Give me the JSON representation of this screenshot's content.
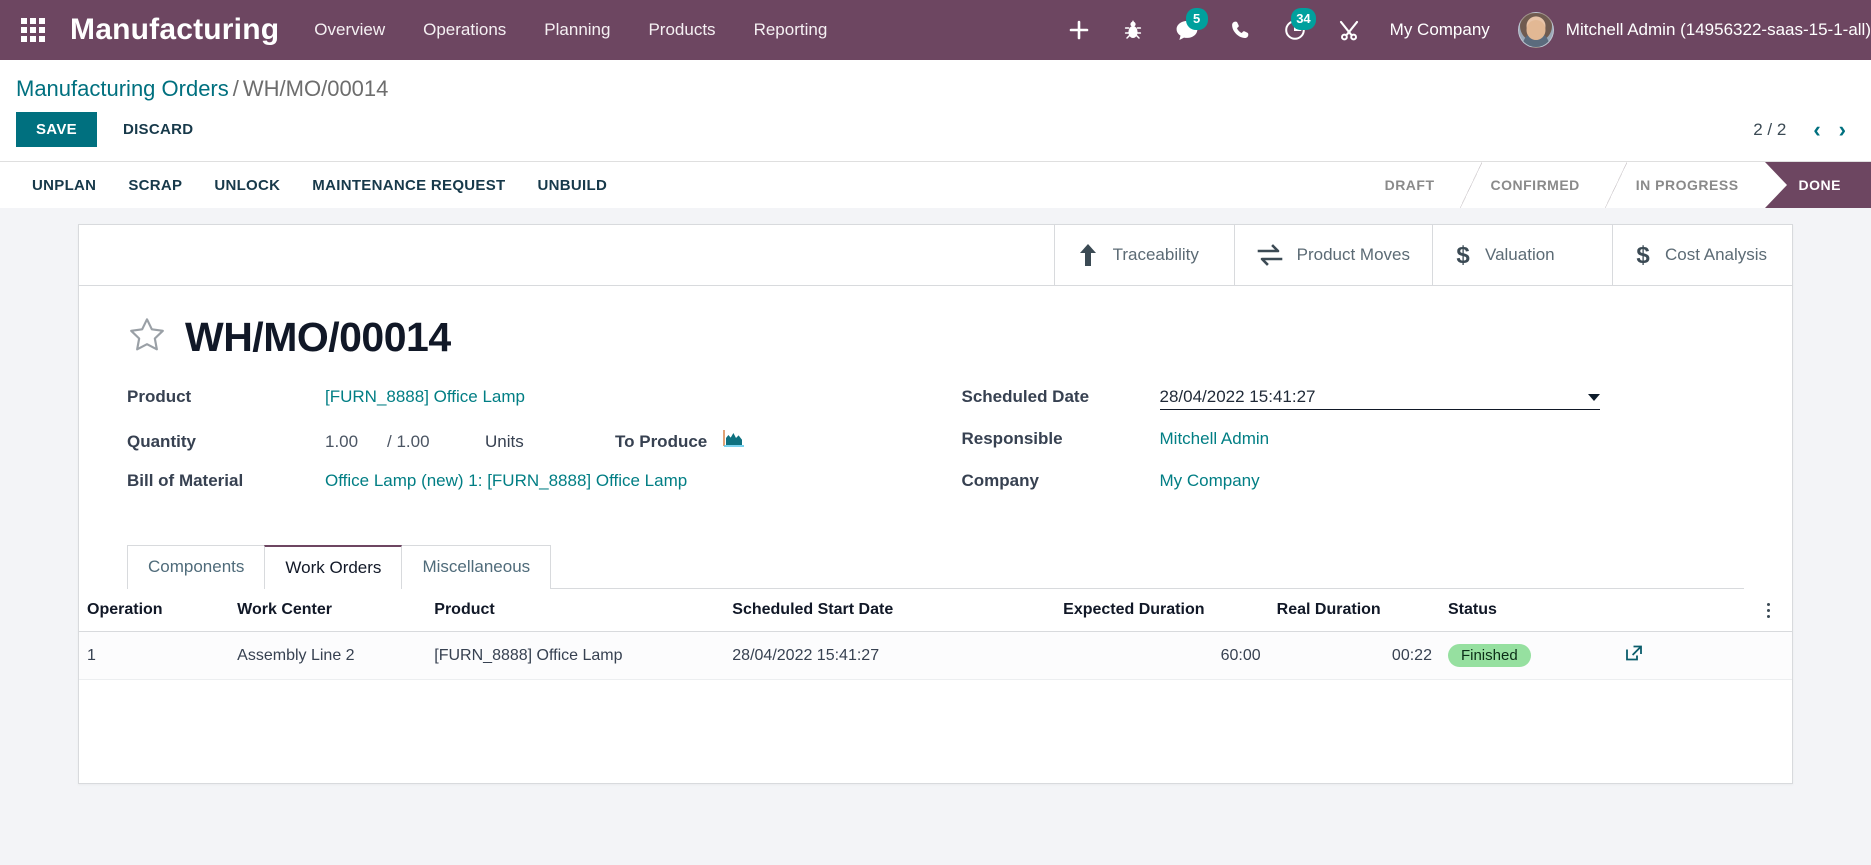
{
  "navbar": {
    "apps_icon": "apps-grid-icon",
    "brand": "Manufacturing",
    "menu": [
      {
        "label": "Overview"
      },
      {
        "label": "Operations"
      },
      {
        "label": "Planning"
      },
      {
        "label": "Products"
      },
      {
        "label": "Reporting"
      }
    ],
    "icons": [
      {
        "name": "plus-icon",
        "badge": ""
      },
      {
        "name": "bug-icon",
        "badge": ""
      },
      {
        "name": "messages-icon",
        "badge": "5"
      },
      {
        "name": "phone-icon",
        "badge": ""
      },
      {
        "name": "activities-clock-icon",
        "badge": "34"
      },
      {
        "name": "tools-icon",
        "badge": ""
      }
    ],
    "company": "My Company",
    "username": "Mitchell Admin (14956322-saas-15-1-all)"
  },
  "control_panel": {
    "breadcrumb_root": "Manufacturing Orders",
    "breadcrumb_sep": "/",
    "breadcrumb_current": "WH/MO/00014",
    "save_label": "SAVE",
    "discard_label": "DISCARD",
    "pager_count": "2 / 2",
    "pager_prev": "‹",
    "pager_next": "›"
  },
  "action_buttons": [
    {
      "label": "UNPLAN"
    },
    {
      "label": "SCRAP"
    },
    {
      "label": "UNLOCK"
    },
    {
      "label": "MAINTENANCE REQUEST"
    },
    {
      "label": "UNBUILD"
    }
  ],
  "statusbar": {
    "stages": [
      {
        "label": "DRAFT",
        "active": false
      },
      {
        "label": "CONFIRMED",
        "active": false
      },
      {
        "label": "IN PROGRESS",
        "active": false
      },
      {
        "label": "DONE",
        "active": true
      }
    ],
    "active_color": "#6D4661"
  },
  "smart_buttons": [
    {
      "label": "Traceability",
      "icon": "arrow-up-icon"
    },
    {
      "label": "Product Moves",
      "icon": "exchange-arrows-icon"
    },
    {
      "label": "Valuation",
      "icon": "dollar-icon"
    },
    {
      "label": "Cost Analysis",
      "icon": "dollar-icon"
    }
  ],
  "record": {
    "title": "WH/MO/00014",
    "favorite_icon": "star-outline-icon",
    "left_fields": {
      "product_label": "Product",
      "product_value": "[FURN_8888] Office Lamp",
      "quantity_label": "Quantity",
      "quantity_value": "1.00",
      "quantity_total": "/ 1.00",
      "uom": "Units",
      "to_produce_label": "To Produce",
      "to_produce_icon": "area-chart-icon",
      "bom_label": "Bill of Material",
      "bom_value": "Office Lamp (new) 1: [FURN_8888] Office Lamp"
    },
    "right_fields": {
      "scheduled_date_label": "Scheduled Date",
      "scheduled_date_value": "28/04/2022 15:41:27",
      "responsible_label": "Responsible",
      "responsible_value": "Mitchell Admin",
      "company_label": "Company",
      "company_value": "My Company"
    }
  },
  "notebook": {
    "tabs": [
      {
        "label": "Components",
        "active": false
      },
      {
        "label": "Work Orders",
        "active": true
      },
      {
        "label": "Miscellaneous",
        "active": false
      }
    ],
    "table": {
      "columns": [
        "Operation",
        "Work Center",
        "Product",
        "Scheduled Start Date",
        "Expected Duration",
        "Real Duration",
        "Status"
      ],
      "rows": [
        {
          "operation": "1",
          "work_center": "Assembly Line 2",
          "product": "[FURN_8888] Office Lamp",
          "scheduled_start_date": "28/04/2022 15:41:27",
          "expected_duration": "60:00",
          "real_duration": "00:22",
          "status": "Finished",
          "status_color": "#96E0A0",
          "action_icon": "external-link-icon"
        }
      ],
      "optional_columns_icon": "vertical-dots-icon"
    }
  },
  "colors": {
    "navbar": "#6D4661",
    "primary": "#00707F",
    "link": "#017E84",
    "badge": "#00A09D",
    "page_bg": "#F3F4F7"
  }
}
